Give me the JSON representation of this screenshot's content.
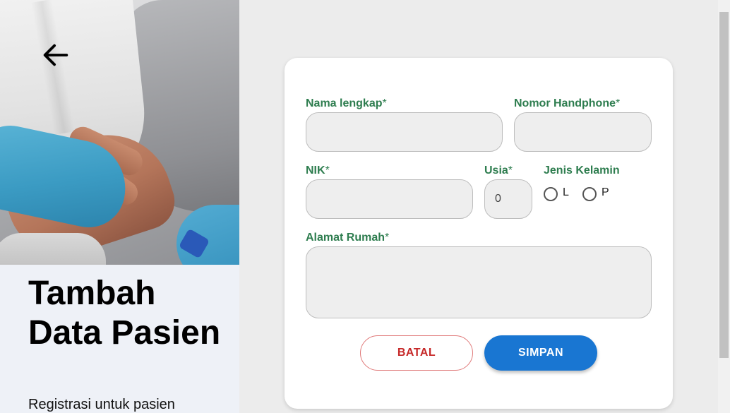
{
  "page": {
    "title": "Tambah Data Pasien",
    "subtitle": "Registrasi untuk pasien"
  },
  "hero": {
    "description": "photo of gloved hands holding a patient's hand"
  },
  "back_button": {
    "icon": "arrow-left-icon"
  },
  "form": {
    "full_name": {
      "label": "Nama lengkap",
      "required_mark": "*",
      "value": ""
    },
    "phone": {
      "label": "Nomor Handphone",
      "required_mark": "*",
      "value": ""
    },
    "nik": {
      "label": "NIK",
      "required_mark": "*",
      "value": ""
    },
    "age": {
      "label": "Usia",
      "required_mark": "*",
      "value": "0"
    },
    "gender": {
      "label": "Jenis Kelamin",
      "options": [
        "L",
        "P"
      ],
      "selected": null
    },
    "address": {
      "label": "Alamat Rumah",
      "required_mark": "*",
      "value": ""
    }
  },
  "buttons": {
    "cancel_label": "BATAL",
    "save_label": "SIMPAN"
  },
  "colors": {
    "label_green": "#2e7d4f",
    "save_blue": "#1976d2",
    "cancel_red": "#c62828",
    "background": "#ececec"
  }
}
